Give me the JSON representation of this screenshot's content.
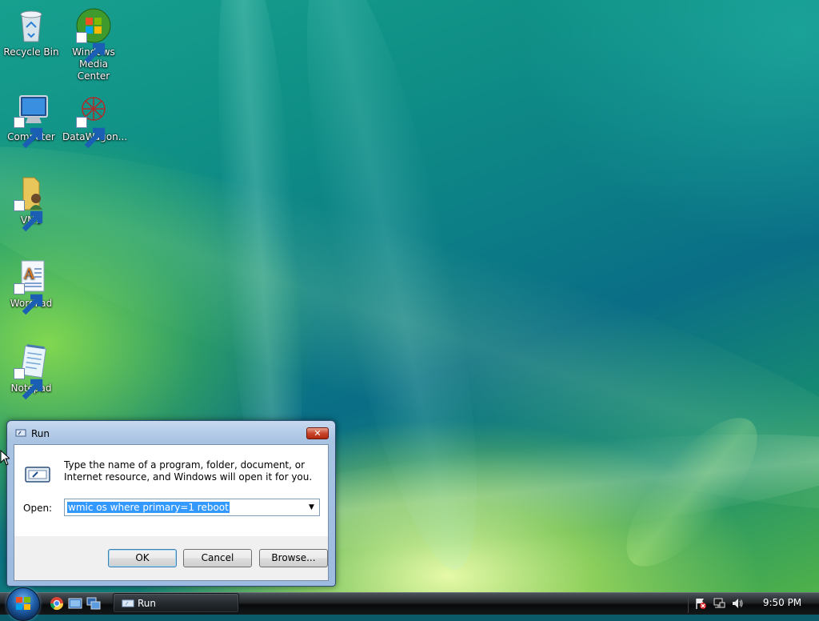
{
  "desktop": {
    "icons": [
      {
        "label_line1": "Recycle Bin",
        "label_line2": "",
        "icon": "recycle-bin-icon"
      },
      {
        "label_line1": "Windows",
        "label_line2": "Media Center",
        "icon": "windows-media-center-icon"
      },
      {
        "label_line1": "Computer",
        "label_line2": "",
        "icon": "computer-icon"
      },
      {
        "label_line1": "DataWagon...",
        "label_line2": "",
        "icon": "datawagon-icon"
      },
      {
        "label_line1": "VM1",
        "label_line2": "",
        "icon": "vm1-folder-icon"
      },
      {
        "label_line1": "WordPad",
        "label_line2": "",
        "icon": "wordpad-icon"
      },
      {
        "label_line1": "Notepad",
        "label_line2": "",
        "icon": "notepad-icon"
      }
    ]
  },
  "run_dialog": {
    "title": "Run",
    "description": "Type the name of a program, folder, document, or Internet resource, and Windows will open it for you.",
    "open_label": "Open:",
    "open_value": "wmic os where primary=1 reboot",
    "ok_label": "OK",
    "cancel_label": "Cancel",
    "browse_label": "Browse..."
  },
  "taskbar": {
    "task_button_label": "Run",
    "clock": "9:50 PM",
    "colors": {
      "accent": "#3399ff",
      "taskbar": "#1f2326"
    }
  }
}
